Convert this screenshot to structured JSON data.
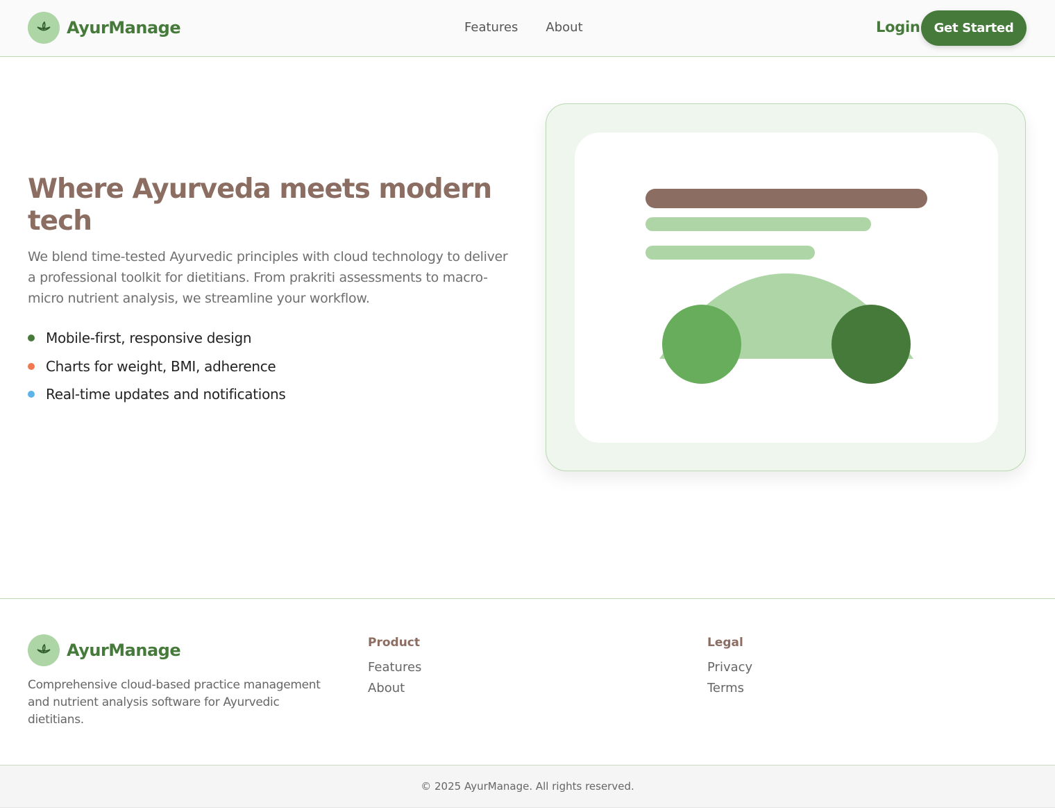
{
  "header": {
    "brand": "AyurManage",
    "logo_icon": "leaf-icon",
    "nav": [
      {
        "label": "Features"
      },
      {
        "label": "About"
      }
    ],
    "login_label": "Login",
    "cta_label": "Get Started"
  },
  "hero": {
    "title": "Where Ayurveda meets modern tech",
    "description": "We blend time-tested Ayurvedic principles with cloud technology to deliver a professional toolkit for dietitians. From prakriti assessments to macro-micro nutrient analysis, we streamline your workflow.",
    "features": [
      {
        "text": "Mobile-first, responsive design",
        "color": "#467a3a"
      },
      {
        "text": "Charts for weight, BMI, adherence",
        "color": "#f07a50"
      },
      {
        "text": "Real-time updates and notifications",
        "color": "#5db3ea"
      }
    ]
  },
  "illustration": {
    "colors": {
      "bar_dark": "#8b6d62",
      "bar_light": "#aed5a6",
      "circle_mid": "#67ad5b",
      "circle_dark": "#467a3a"
    }
  },
  "footer": {
    "brand": "AyurManage",
    "description": "Comprehensive cloud-based practice management and nutrient analysis software for Ayurvedic dietitians.",
    "columns": [
      {
        "heading": "Product",
        "links": [
          "Features",
          "About"
        ]
      },
      {
        "heading": "Legal",
        "links": [
          "Privacy",
          "Terms"
        ]
      }
    ],
    "copyright": "© 2025 AyurManage. All rights reserved."
  },
  "theme": {
    "primary": "#467a3a",
    "accent_light": "#aed5a6",
    "heading_brown": "#8b6d62"
  }
}
